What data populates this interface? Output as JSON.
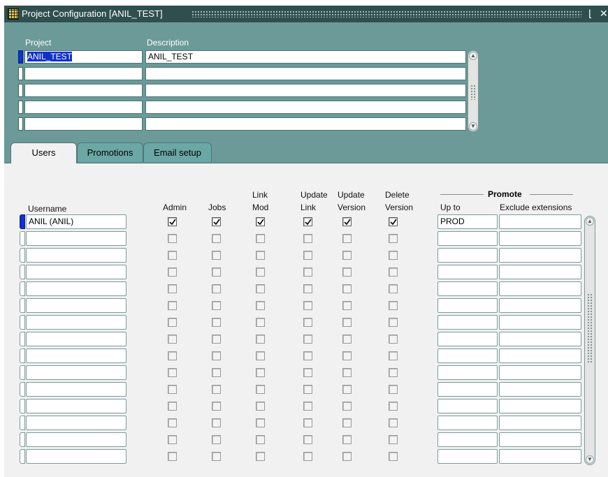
{
  "window": {
    "title": "Project Configuration [ANIL_TEST]",
    "minimize_glyph": "⌊",
    "close_glyph": "✕"
  },
  "project_block": {
    "col_project": "Project",
    "col_description": "Description",
    "rows": [
      {
        "project": "ANIL_TEST",
        "description": "ANIL_TEST"
      },
      {
        "project": "",
        "description": ""
      },
      {
        "project": "",
        "description": ""
      },
      {
        "project": "",
        "description": ""
      },
      {
        "project": "",
        "description": ""
      }
    ]
  },
  "tabs": [
    {
      "label": "Users",
      "active": true
    },
    {
      "label": "Promotions",
      "active": false
    },
    {
      "label": "Email setup",
      "active": false
    }
  ],
  "users": {
    "headers": {
      "username": "Username",
      "admin": "Admin",
      "jobs": "Jobs",
      "link_mod": [
        "Link",
        "Mod"
      ],
      "update_link": [
        "Update",
        "Link"
      ],
      "update_version": [
        "Update",
        "Version"
      ],
      "delete_version": [
        "Delete",
        "Version"
      ],
      "promote": "Promote",
      "up_to": "Up to",
      "exclude_extensions": "Exclude extensions"
    },
    "rows": [
      {
        "username": "ANIL (ANIL)",
        "admin": true,
        "jobs": true,
        "link_mod": true,
        "update_link": true,
        "update_version": true,
        "delete_version": true,
        "up_to": "PROD",
        "exclude": ""
      },
      {
        "username": "",
        "admin": false,
        "jobs": false,
        "link_mod": false,
        "update_link": false,
        "update_version": false,
        "delete_version": false,
        "up_to": "",
        "exclude": ""
      },
      {
        "username": "",
        "admin": false,
        "jobs": false,
        "link_mod": false,
        "update_link": false,
        "update_version": false,
        "delete_version": false,
        "up_to": "",
        "exclude": ""
      },
      {
        "username": "",
        "admin": false,
        "jobs": false,
        "link_mod": false,
        "update_link": false,
        "update_version": false,
        "delete_version": false,
        "up_to": "",
        "exclude": ""
      },
      {
        "username": "",
        "admin": false,
        "jobs": false,
        "link_mod": false,
        "update_link": false,
        "update_version": false,
        "delete_version": false,
        "up_to": "",
        "exclude": ""
      },
      {
        "username": "",
        "admin": false,
        "jobs": false,
        "link_mod": false,
        "update_link": false,
        "update_version": false,
        "delete_version": false,
        "up_to": "",
        "exclude": ""
      },
      {
        "username": "",
        "admin": false,
        "jobs": false,
        "link_mod": false,
        "update_link": false,
        "update_version": false,
        "delete_version": false,
        "up_to": "",
        "exclude": ""
      },
      {
        "username": "",
        "admin": false,
        "jobs": false,
        "link_mod": false,
        "update_link": false,
        "update_version": false,
        "delete_version": false,
        "up_to": "",
        "exclude": ""
      },
      {
        "username": "",
        "admin": false,
        "jobs": false,
        "link_mod": false,
        "update_link": false,
        "update_version": false,
        "delete_version": false,
        "up_to": "",
        "exclude": ""
      },
      {
        "username": "",
        "admin": false,
        "jobs": false,
        "link_mod": false,
        "update_link": false,
        "update_version": false,
        "delete_version": false,
        "up_to": "",
        "exclude": ""
      },
      {
        "username": "",
        "admin": false,
        "jobs": false,
        "link_mod": false,
        "update_link": false,
        "update_version": false,
        "delete_version": false,
        "up_to": "",
        "exclude": ""
      },
      {
        "username": "",
        "admin": false,
        "jobs": false,
        "link_mod": false,
        "update_link": false,
        "update_version": false,
        "delete_version": false,
        "up_to": "",
        "exclude": ""
      },
      {
        "username": "",
        "admin": false,
        "jobs": false,
        "link_mod": false,
        "update_link": false,
        "update_version": false,
        "delete_version": false,
        "up_to": "",
        "exclude": ""
      },
      {
        "username": "",
        "admin": false,
        "jobs": false,
        "link_mod": false,
        "update_link": false,
        "update_version": false,
        "delete_version": false,
        "up_to": "",
        "exclude": ""
      },
      {
        "username": "",
        "admin": false,
        "jobs": false,
        "link_mod": false,
        "update_link": false,
        "update_version": false,
        "delete_version": false,
        "up_to": "",
        "exclude": ""
      }
    ]
  },
  "colors": {
    "canvas": "#6b9a98",
    "titlebar": "#2f4f4f",
    "current_record": "#1030d0",
    "tab_inactive": "#6aa7a5",
    "panel": "#f1f1f1"
  }
}
